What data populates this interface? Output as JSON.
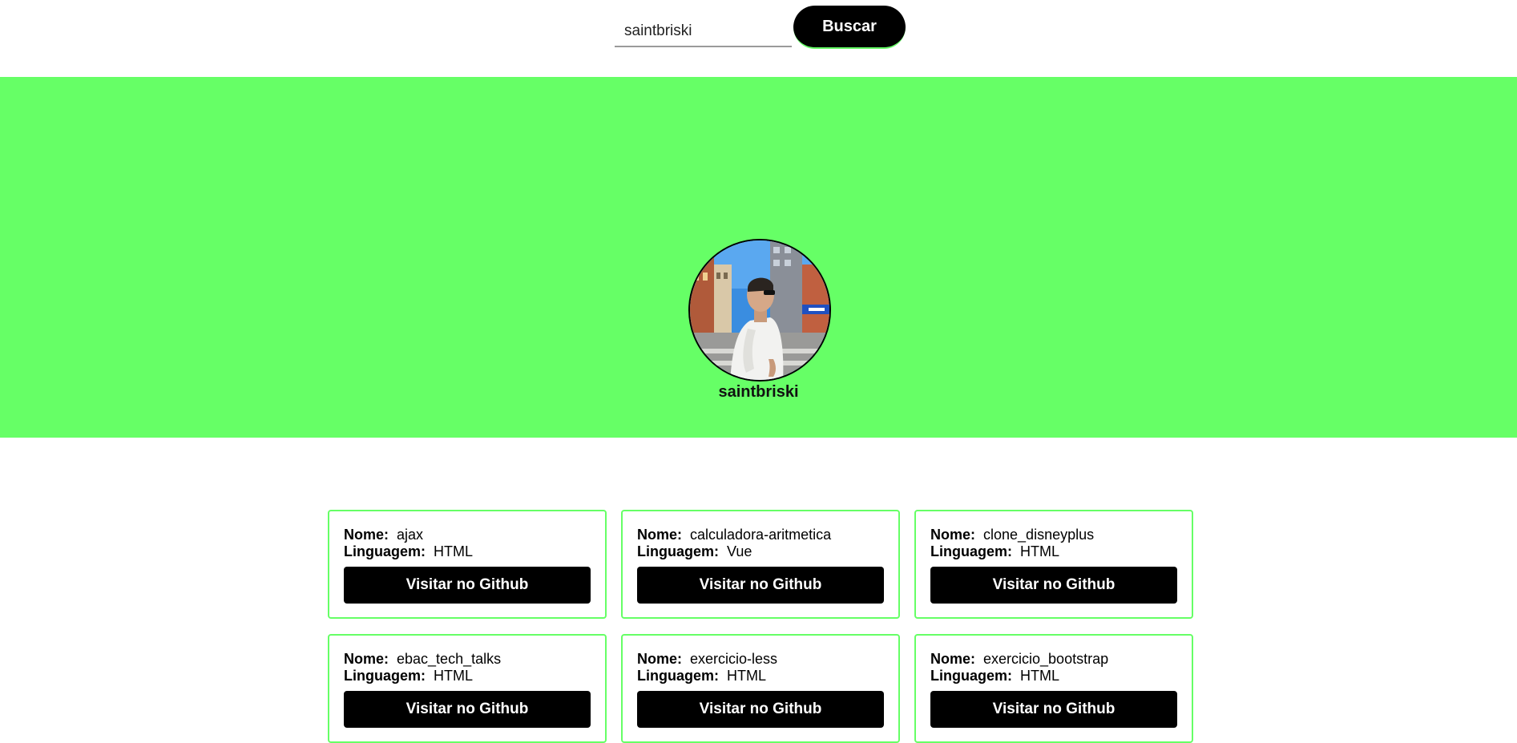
{
  "search": {
    "value": "saintbriski",
    "button_label": "Buscar"
  },
  "profile": {
    "username": "saintbriski"
  },
  "colors": {
    "accent": "#66ff66",
    "button": "#000000"
  },
  "repo_labels": {
    "name": "Nome:",
    "language": "Linguagem:",
    "visit": "Visitar no Github"
  },
  "repos": [
    {
      "name": "ajax",
      "language": "HTML"
    },
    {
      "name": "calculadora-aritmetica",
      "language": "Vue"
    },
    {
      "name": "clone_disneyplus",
      "language": "HTML"
    },
    {
      "name": "ebac_tech_talks",
      "language": "HTML"
    },
    {
      "name": "exercicio-less",
      "language": "HTML"
    },
    {
      "name": "exercicio_bootstrap",
      "language": "HTML"
    }
  ]
}
